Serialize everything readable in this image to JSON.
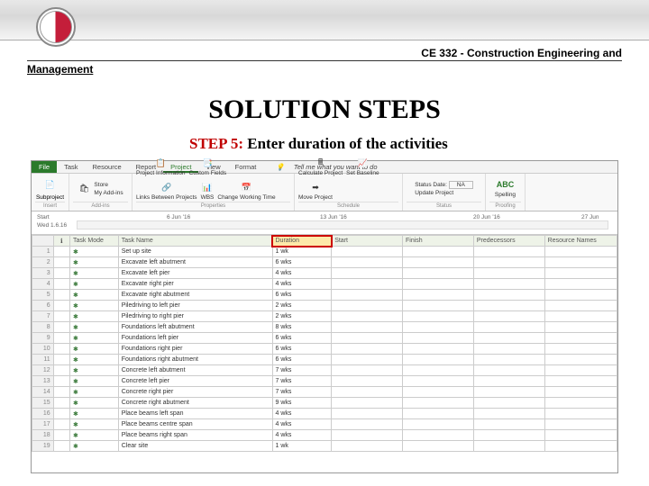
{
  "header": {
    "course": "CE 332 - Construction Engineering and",
    "course_sub": "Management"
  },
  "title": "SOLUTION STEPS",
  "step": {
    "label": "STEP 5:",
    "text": " Enter duration of the activities"
  },
  "ribbon": {
    "tabs": [
      "File",
      "Task",
      "Resource",
      "Report",
      "Project",
      "View",
      "Format"
    ],
    "tell": "Tell me what you want to do",
    "groups": {
      "insert": "Insert",
      "addins": "Add-ins",
      "properties": "Properties",
      "schedule": "Schedule",
      "status": "Status",
      "proofing": "Proofing"
    },
    "items": {
      "subproject": "Subproject",
      "store": "Store",
      "myaddins": "My Add-ins",
      "project_info": "Project Information",
      "custom_fields": "Custom Fields",
      "links": "Links Between Projects",
      "wbs": "WBS",
      "change_wt": "Change Working Time",
      "calculate": "Calculate Project",
      "set_baseline": "Set Baseline",
      "move_project": "Move Project",
      "status_date": "Status Date:",
      "na": "NA",
      "update_project": "Update Project",
      "spelling": "Spelling"
    }
  },
  "timeline": {
    "start_label": "Start",
    "start_date": "Wed 1.6.16",
    "tick1": "6 Jun '16",
    "tick2": "13 Jun '16",
    "tick3": "20 Jun '16",
    "tick4": "27 Jun"
  },
  "columns": {
    "info": "ℹ",
    "mode": "Task Mode",
    "name": "Task Name",
    "duration": "Duration",
    "start": "Start",
    "finish": "Finish",
    "pred": "Predecessors",
    "res": "Resource Names"
  },
  "rows": [
    {
      "n": "1",
      "name": "Set up site",
      "dur": "1 wk"
    },
    {
      "n": "2",
      "name": "Excavate left abutment",
      "dur": "6 wks"
    },
    {
      "n": "3",
      "name": "Excavate left pier",
      "dur": "4 wks"
    },
    {
      "n": "4",
      "name": "Excavate right pier",
      "dur": "4 wks"
    },
    {
      "n": "5",
      "name": "Excavate right abutment",
      "dur": "6 wks"
    },
    {
      "n": "6",
      "name": "Piledriving to left pier",
      "dur": "2 wks"
    },
    {
      "n": "7",
      "name": "Piledriving to right pier",
      "dur": "2 wks"
    },
    {
      "n": "8",
      "name": "Foundations left abutment",
      "dur": "8 wks"
    },
    {
      "n": "9",
      "name": "Foundations left pier",
      "dur": "6 wks"
    },
    {
      "n": "10",
      "name": "Foundations right pier",
      "dur": "6 wks"
    },
    {
      "n": "11",
      "name": "Foundations right abutment",
      "dur": "6 wks"
    },
    {
      "n": "12",
      "name": "Concrete left abutment",
      "dur": "7 wks"
    },
    {
      "n": "13",
      "name": "Concrete left pier",
      "dur": "7 wks"
    },
    {
      "n": "14",
      "name": "Concrete right pier",
      "dur": "7 wks"
    },
    {
      "n": "15",
      "name": "Concrete right abutment",
      "dur": "9 wks"
    },
    {
      "n": "16",
      "name": "Place beams left span",
      "dur": "4 wks"
    },
    {
      "n": "17",
      "name": "Place beams centre span",
      "dur": "4 wks"
    },
    {
      "n": "18",
      "name": "Place beams right span",
      "dur": "4 wks"
    },
    {
      "n": "19",
      "name": "Clear site",
      "dur": "1 wk"
    }
  ]
}
